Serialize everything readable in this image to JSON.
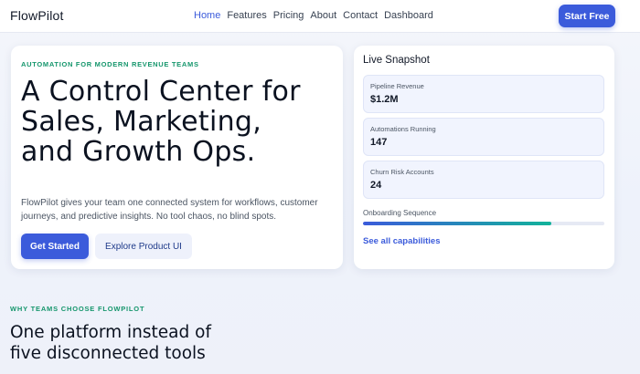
{
  "nav": {
    "brand": "FlowPilot",
    "items": [
      {
        "label": "Home",
        "active": true
      },
      {
        "label": "Features"
      },
      {
        "label": "Pricing"
      },
      {
        "label": "About"
      },
      {
        "label": "Contact"
      },
      {
        "label": "Dashboard"
      }
    ],
    "cta": "Start Free"
  },
  "hero": {
    "eyebrow": "AUTOMATION FOR MODERN REVENUE TEAMS",
    "headline_lines": [
      "A Control Center for",
      "Sales, Marketing,",
      "and Growth Ops."
    ],
    "subtext_lines": [
      "FlowPilot gives your team one connected system for workflows, customer",
      "journeys, and predictive insights. No tool chaos, no blind spots."
    ],
    "primary_button": "Get Started",
    "secondary_button": "Explore Product UI"
  },
  "snapshot": {
    "title": "Live Snapshot",
    "stats": [
      {
        "label": "Pipeline Revenue",
        "value": "$1.2M"
      },
      {
        "label": "Automations Running",
        "value": "147"
      },
      {
        "label": "Churn Risk Accounts",
        "value": "24"
      }
    ],
    "progress_label": "Onboarding Sequence",
    "progress_fraction": 0.78,
    "link": "See all capabilities"
  },
  "section": {
    "eyebrow": "WHY TEAMS CHOOSE FLOWPILOT",
    "heading_lines": [
      "One platform instead of",
      "five disconnected tools"
    ]
  },
  "colors": {
    "accent": "#3b5bdb",
    "eyebrow_green": "#15966c",
    "progress_end": "#12b39a"
  }
}
